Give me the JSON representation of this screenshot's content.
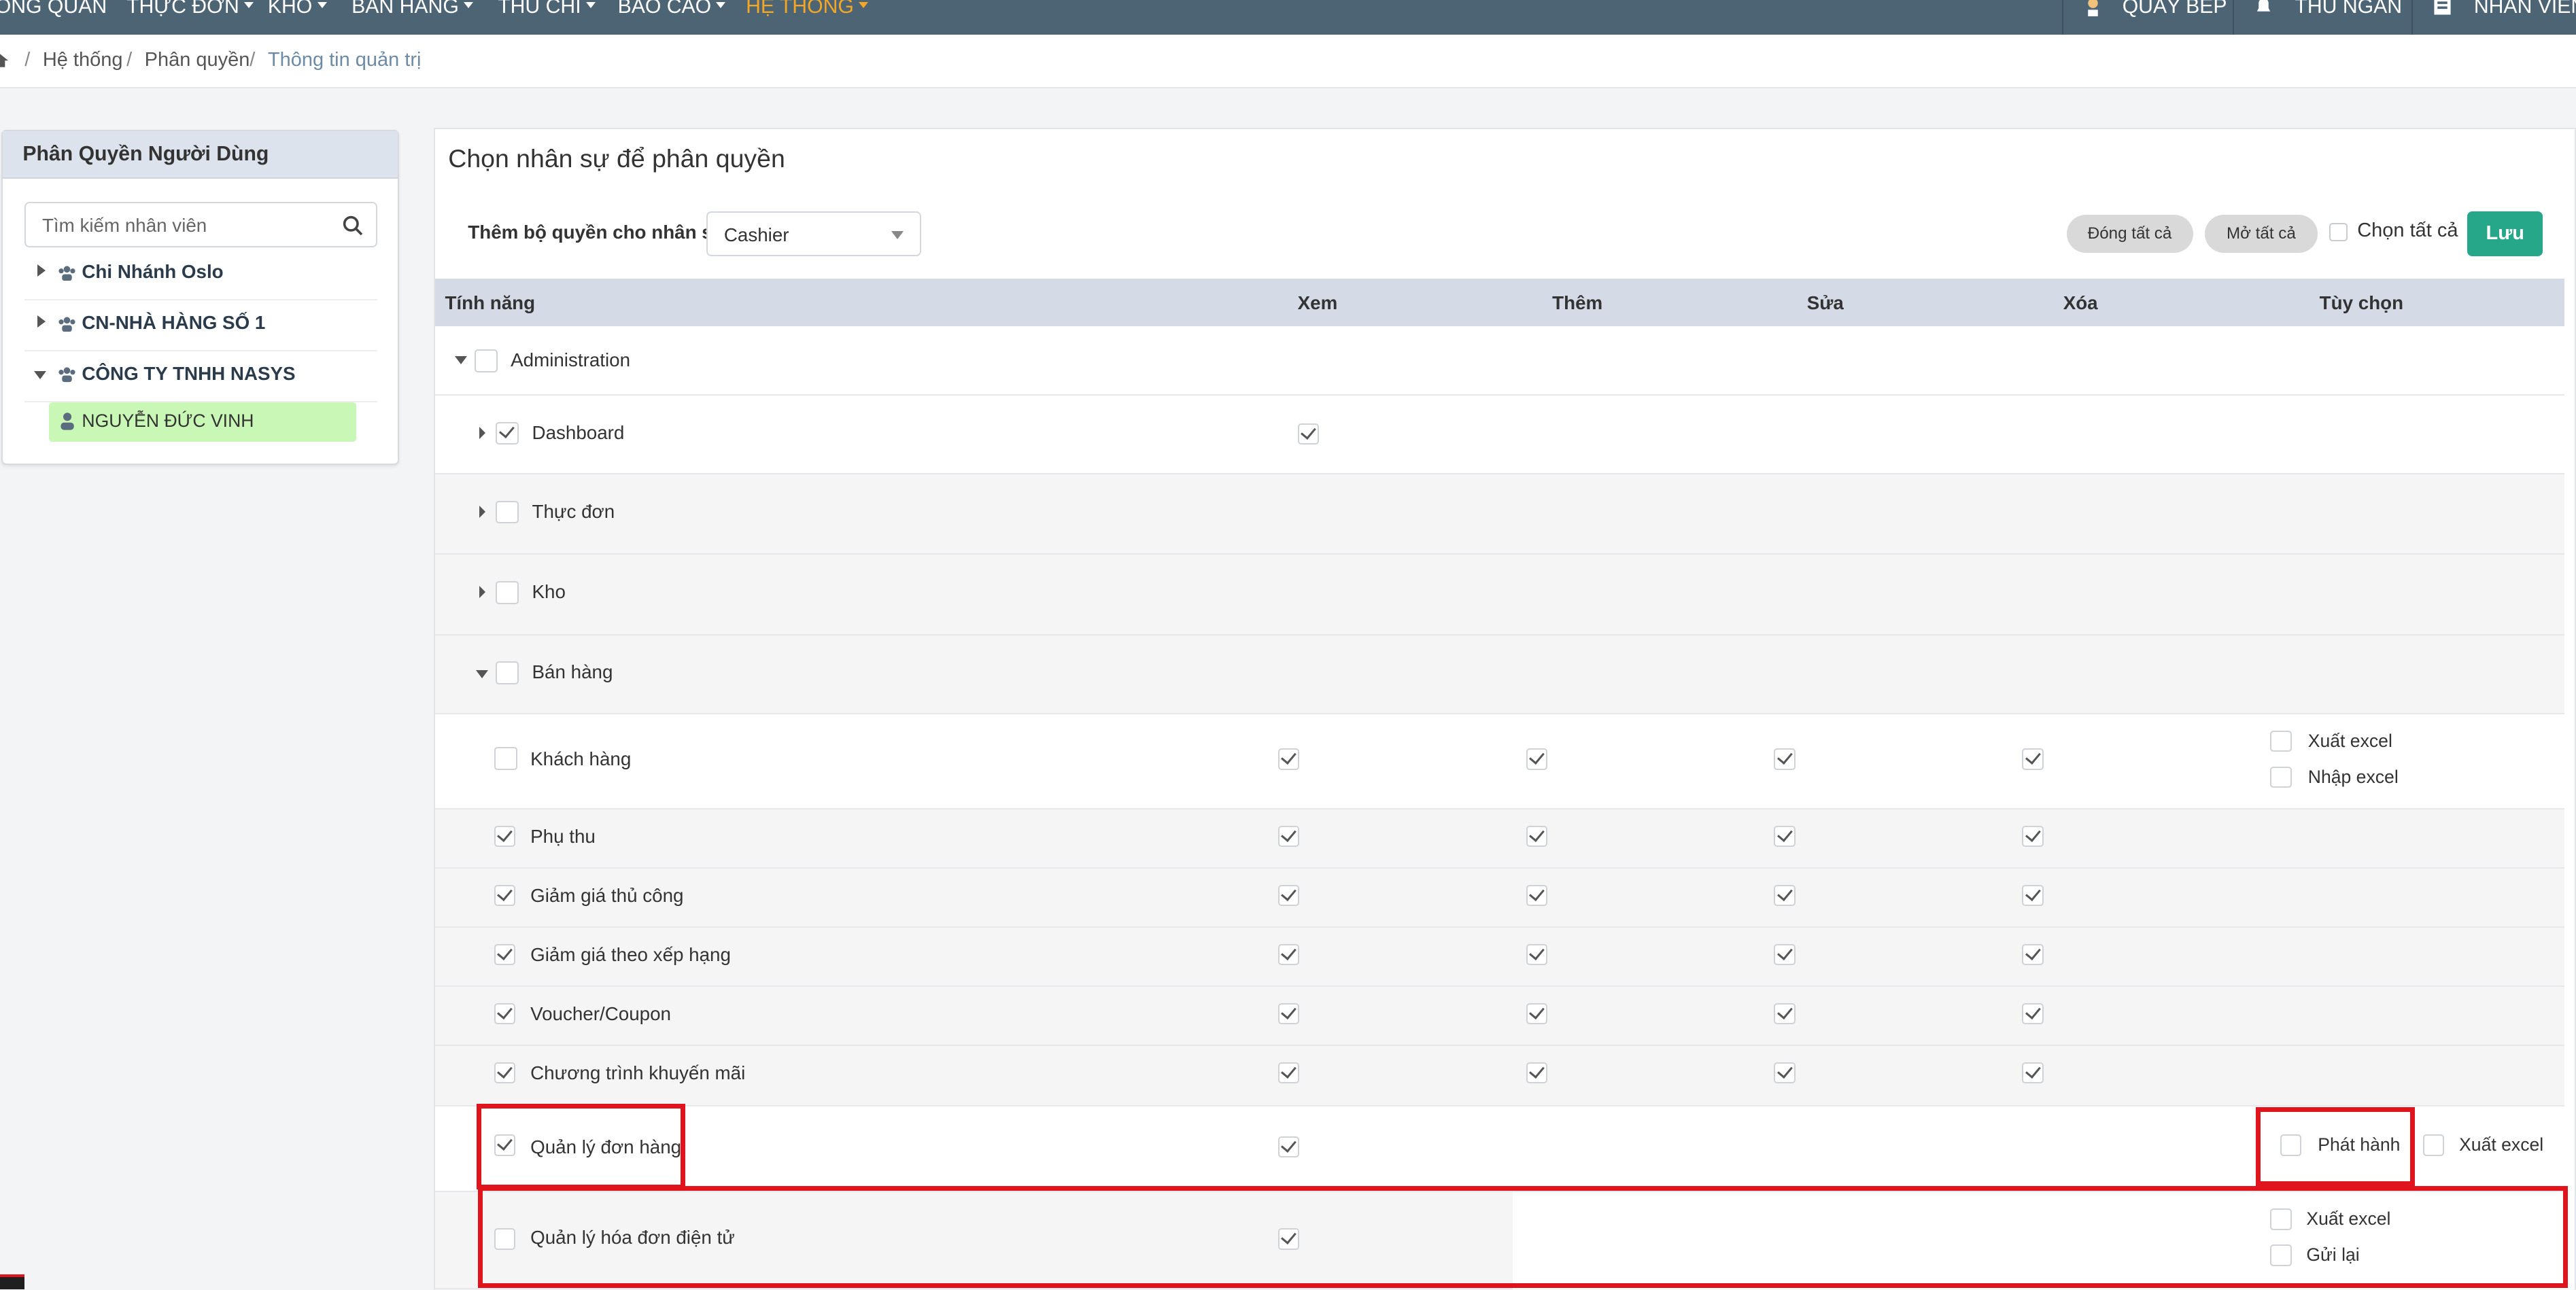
{
  "nav": {
    "items": [
      {
        "label": "ỔNG QUAN",
        "caret": false
      },
      {
        "label": "THỰC ĐƠN",
        "caret": true
      },
      {
        "label": "KHO",
        "caret": true
      },
      {
        "label": "BÁN HÀNG",
        "caret": true
      },
      {
        "label": "THU CHI",
        "caret": true
      },
      {
        "label": "BÁO CÁO",
        "caret": true
      },
      {
        "label": "HỆ THỐNG",
        "caret": true,
        "active": true
      }
    ],
    "right": [
      {
        "label": "QUẦY BẾP",
        "icon": "chef-icon"
      },
      {
        "label": "THU NGÂN",
        "icon": "bell-icon"
      },
      {
        "label": "NHÂN VIÊN",
        "icon": "staff-icon"
      }
    ],
    "active_color": "#f5a623",
    "bar_color": "#4d6475"
  },
  "breadcrumb": {
    "items": [
      "Hệ thống",
      "Phân quyền",
      "Thông tin quản trị"
    ],
    "separator": "/"
  },
  "left": {
    "title": "Phân Quyền Người Dùng",
    "search_placeholder": "Tìm kiếm nhân viên",
    "tree": [
      {
        "label": "Chi Nhánh Oslo",
        "expanded": false
      },
      {
        "label": "CN-NHÀ HÀNG SỐ 1",
        "expanded": false
      },
      {
        "label": "CÔNG TY TNHH NASYS",
        "expanded": true
      }
    ],
    "selected_user": "NGUYỄN ĐỨC VINH",
    "selected_color": "#c9f7b5"
  },
  "main": {
    "title": "Chọn nhân sự để phân quyền",
    "role_label": "Thêm bộ quyền cho nhân sự",
    "role_value": "Cashier",
    "collapse_all": "Đóng tất cả",
    "expand_all": "Mở tất cả",
    "select_all": "Chọn tất cả",
    "save": "Lưu",
    "save_color": "#27a78a",
    "columns": {
      "feature": "Tính năng",
      "view": "Xem",
      "add": "Thêm",
      "edit": "Sửa",
      "delete": "Xóa",
      "options": "Tùy chọn"
    },
    "rows": [
      {
        "label": "Administration",
        "checked": false
      },
      {
        "label": "Dashboard",
        "checked": true,
        "view": true
      },
      {
        "label": "Thực đơn",
        "checked": false
      },
      {
        "label": "Kho",
        "checked": false
      },
      {
        "label": "Bán hàng",
        "checked": false
      },
      {
        "label": "Khách hàng",
        "checked": false,
        "view": true,
        "add": true,
        "edit": true,
        "delete": true,
        "options": [
          "Xuất excel",
          "Nhập excel"
        ]
      },
      {
        "label": "Phụ thu",
        "checked": true,
        "view": true,
        "add": true,
        "edit": true,
        "delete": true
      },
      {
        "label": "Giảm giá thủ công",
        "checked": true,
        "view": true,
        "add": true,
        "edit": true,
        "delete": true
      },
      {
        "label": "Giảm giá theo xếp hạng",
        "checked": true,
        "view": true,
        "add": true,
        "edit": true,
        "delete": true
      },
      {
        "label": "Voucher/Coupon",
        "checked": true,
        "view": true,
        "add": true,
        "edit": true,
        "delete": true
      },
      {
        "label": "Chương trình khuyến mãi",
        "checked": true,
        "view": true,
        "add": true,
        "edit": true,
        "delete": true
      },
      {
        "label": "Quản lý đơn hàng",
        "checked": true,
        "view": true,
        "options": [
          "Phát hành",
          "Xuất excel"
        ]
      },
      {
        "label": "Quản lý hóa đơn điện tử",
        "checked": false,
        "view": true,
        "options": [
          "Xuất excel",
          "Gửi lại"
        ]
      }
    ]
  },
  "highlight_color": "#e0141d"
}
